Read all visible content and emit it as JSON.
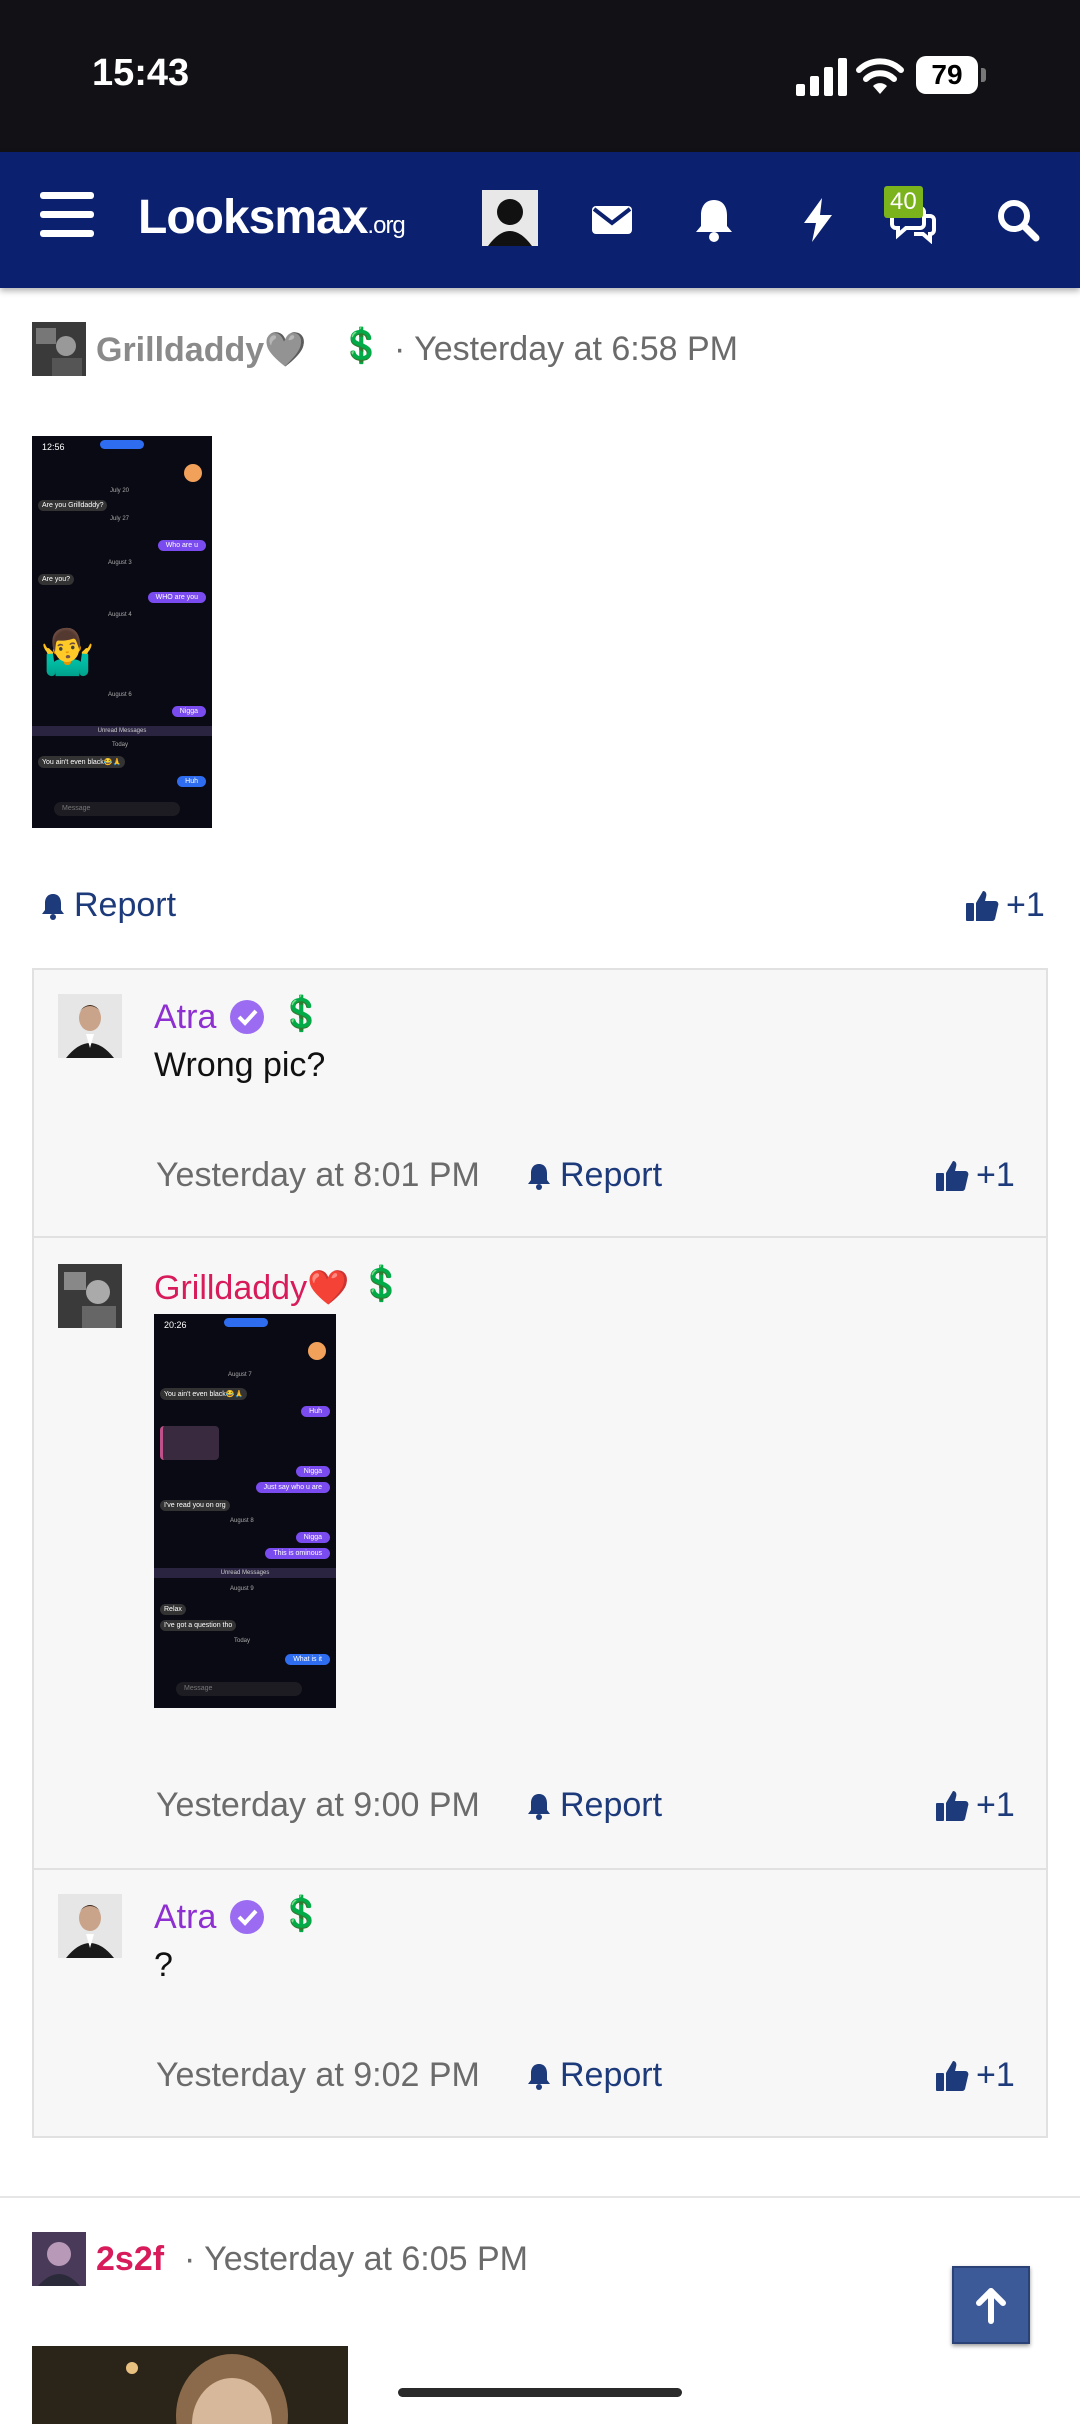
{
  "status_bar": {
    "time": "15:43",
    "battery": "79"
  },
  "navbar": {
    "logo_main": "Looksmax",
    "logo_suffix": ".org",
    "conversations_badge": "40"
  },
  "post": {
    "author": "Grilldaddy🩶",
    "author_badge": "💲",
    "time": "· Yesterday at 6:58 PM",
    "report_label": "Report",
    "reaction_count": "+1",
    "screenshot": {
      "time": "12:56",
      "dates": [
        "July 20",
        "July 27",
        "August 3",
        "August 4",
        "August 6",
        "Unread Messages",
        "Today"
      ],
      "messages": [
        "Are you Grilldaddy?",
        "Who are u",
        "Are you?",
        "WHO are you",
        "Nigga",
        "You ain't even black😂🙏",
        "Huh"
      ],
      "emoji": "🤷‍♂️",
      "input_placeholder": "Message"
    }
  },
  "comments": [
    {
      "author": "Atra",
      "author_color": "#8e2fd1",
      "verified": true,
      "badge": "💲",
      "text": "Wrong pic?",
      "time": "Yesterday at 8:01 PM",
      "report_label": "Report",
      "reaction_count": "+1"
    },
    {
      "author": "Grilldaddy❤️",
      "author_color": "#d81b5a",
      "verified": false,
      "badge": "💲",
      "text": "",
      "time": "Yesterday at 9:00 PM",
      "report_label": "Report",
      "reaction_count": "+1",
      "screenshot": {
        "time": "20:26",
        "dates": [
          "August 7",
          "August 8",
          "Unread Messages",
          "August 9",
          "Today"
        ],
        "messages": [
          "You ain't even black😂🙏",
          "Huh",
          "Nigga",
          "Just say who u are",
          "I've read you on org",
          "Nigga",
          "This is ominous",
          "Relax",
          "I've got a question tho",
          "What is it"
        ],
        "input_placeholder": "Message"
      }
    },
    {
      "author": "Atra",
      "author_color": "#8e2fd1",
      "verified": true,
      "badge": "💲",
      "text": "?",
      "time": "Yesterday at 9:02 PM",
      "report_label": "Report",
      "reaction_count": "+1"
    }
  ],
  "next_post": {
    "author": "2s2f",
    "time": "· Yesterday at 6:05 PM"
  },
  "colors": {
    "nav_bg": "#0b2170",
    "link": "#1d3a7a",
    "atra": "#8e2fd1",
    "grilldaddy": "#d81b5a"
  }
}
